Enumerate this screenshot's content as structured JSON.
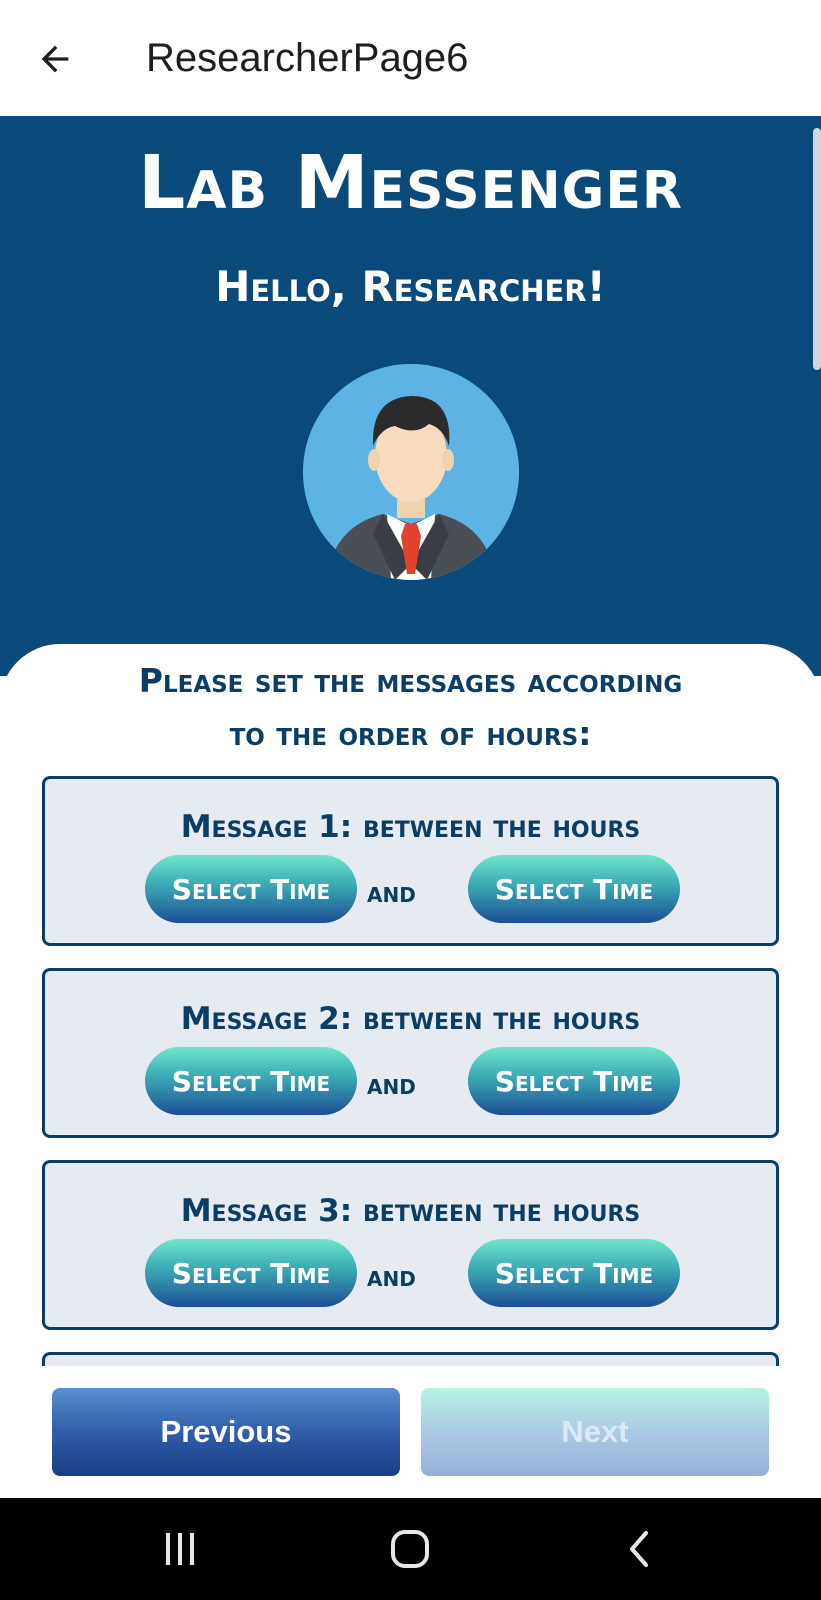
{
  "appbar": {
    "title": "ResearcherPage6",
    "back_icon": "arrow-left-icon"
  },
  "header": {
    "app_title": "Lab Messenger",
    "greeting": "Hello, Researcher!",
    "avatar_icon": "researcher-avatar"
  },
  "instructions": {
    "line1": "Please set the messages according",
    "line2": "to the order of hours:"
  },
  "messages": [
    {
      "label": "Message 1: between the hours",
      "start_button": "Select Time",
      "and_text": "and",
      "end_button": "Select Time"
    },
    {
      "label": "Message 2: between the hours",
      "start_button": "Select Time",
      "and_text": "and",
      "end_button": "Select Time"
    },
    {
      "label": "Message 3: between the hours",
      "start_button": "Select Time",
      "and_text": "and",
      "end_button": "Select Time"
    }
  ],
  "footer": {
    "previous_label": "Previous",
    "next_label": "Next",
    "next_enabled": false
  },
  "system_nav": {
    "recents_icon": "recents-icon",
    "home_icon": "home-icon",
    "back_icon": "back-chevron-icon"
  },
  "colors": {
    "primary": "#0a4a7a",
    "text_dark": "#0b3e66",
    "card_bg": "#e6ebf2",
    "accent_teal": "#6fe6c8"
  }
}
